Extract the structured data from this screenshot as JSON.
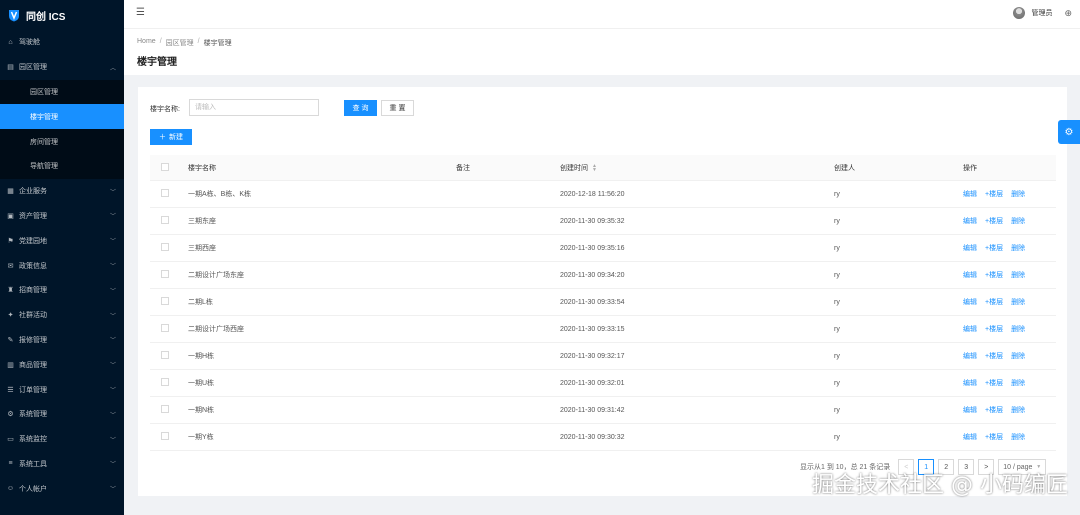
{
  "app": {
    "title": "同创 ICS"
  },
  "sidebar": {
    "items": [
      {
        "label": "驾驶舱",
        "icon": "dashboard-icon",
        "has_arrow": false
      },
      {
        "label": "园区管理",
        "icon": "park-icon",
        "has_arrow": true,
        "expanded": true,
        "children": [
          {
            "label": "园区管理",
            "active": false
          },
          {
            "label": "楼宇管理",
            "active": true
          },
          {
            "label": "房间管理",
            "active": false
          },
          {
            "label": "导航管理",
            "active": false
          }
        ]
      },
      {
        "label": "企业服务",
        "icon": "enterprise-icon",
        "has_arrow": true
      },
      {
        "label": "资产管理",
        "icon": "asset-icon",
        "has_arrow": true
      },
      {
        "label": "党建园地",
        "icon": "party-icon",
        "has_arrow": true
      },
      {
        "label": "政策信息",
        "icon": "policy-icon",
        "has_arrow": true
      },
      {
        "label": "招商管理",
        "icon": "investment-icon",
        "has_arrow": true
      },
      {
        "label": "社群活动",
        "icon": "community-icon",
        "has_arrow": true
      },
      {
        "label": "报修管理",
        "icon": "repair-icon",
        "has_arrow": true
      },
      {
        "label": "商品管理",
        "icon": "goods-icon",
        "has_arrow": true
      },
      {
        "label": "订单管理",
        "icon": "order-icon",
        "has_arrow": true
      },
      {
        "label": "系统管理",
        "icon": "system-icon",
        "has_arrow": true
      },
      {
        "label": "系统监控",
        "icon": "monitor-icon",
        "has_arrow": true
      },
      {
        "label": "系统工具",
        "icon": "tools-icon",
        "has_arrow": true
      },
      {
        "label": "个人帐户",
        "icon": "account-icon",
        "has_arrow": true
      }
    ]
  },
  "header": {
    "username": "管理员"
  },
  "breadcrumb": {
    "home": "Home",
    "level1": "园区管理",
    "current": "楼宇管理",
    "sep": "/"
  },
  "page": {
    "title": "楼宇管理"
  },
  "search": {
    "label": "楼宇名称:",
    "placeholder": "请输入",
    "value": "",
    "query_label": "查 询",
    "reset_label": "重 置"
  },
  "toolbar": {
    "new_label": "新建"
  },
  "table": {
    "columns": {
      "name": "楼宇名称",
      "note": "备注",
      "time": "创建时间",
      "creator": "创建人",
      "ops": "操作"
    },
    "ops": {
      "edit": "编辑",
      "floor": "+楼层",
      "delete": "删除"
    },
    "rows": [
      {
        "name": "一期A栋、B栋、K栋",
        "note": "",
        "time": "2020-12-18 11:56:20",
        "creator": "ry"
      },
      {
        "name": "三期东座",
        "note": "",
        "time": "2020-11-30 09:35:32",
        "creator": "ry"
      },
      {
        "name": "三期西座",
        "note": "",
        "time": "2020-11-30 09:35:16",
        "creator": "ry"
      },
      {
        "name": "二期设计广场东座",
        "note": "",
        "time": "2020-11-30 09:34:20",
        "creator": "ry"
      },
      {
        "name": "二期L栋",
        "note": "",
        "time": "2020-11-30 09:33:54",
        "creator": "ry"
      },
      {
        "name": "二期设计广场西座",
        "note": "",
        "time": "2020-11-30 09:33:15",
        "creator": "ry"
      },
      {
        "name": "一期H栋",
        "note": "",
        "time": "2020-11-30 09:32:17",
        "creator": "ry"
      },
      {
        "name": "一期U栋",
        "note": "",
        "time": "2020-11-30 09:32:01",
        "creator": "ry"
      },
      {
        "name": "一期N栋",
        "note": "",
        "time": "2020-11-30 09:31:42",
        "creator": "ry"
      },
      {
        "name": "一期Y栋",
        "note": "",
        "time": "2020-11-30 09:30:32",
        "creator": "ry"
      }
    ]
  },
  "pagination": {
    "summary": "显示从1 到 10，总 21 条记录",
    "pages": [
      "1",
      "2",
      "3"
    ],
    "current": "1",
    "prev": "<",
    "next": ">",
    "page_size": "10 / page"
  },
  "watermark": "掘金技术社区 @ 小码编匠",
  "colors": {
    "sidebar_bg": "#001529",
    "accent": "#1890ff"
  }
}
